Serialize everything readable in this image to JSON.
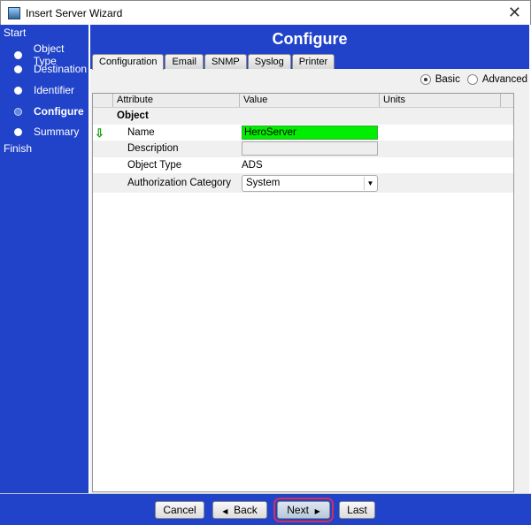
{
  "window": {
    "title": "Insert Server Wizard",
    "close": "✕"
  },
  "sidebar": {
    "start": "Start",
    "finish": "Finish",
    "items": [
      {
        "label": "Object Type",
        "current": false
      },
      {
        "label": "Destination",
        "current": false
      },
      {
        "label": "Identifier",
        "current": false
      },
      {
        "label": "Configure",
        "current": true
      },
      {
        "label": "Summary",
        "current": false
      }
    ]
  },
  "header": {
    "title": "Configure"
  },
  "tabs": [
    "Configuration",
    "Email",
    "SNMP",
    "Syslog",
    "Printer"
  ],
  "mode": {
    "basic": "Basic",
    "advanced": "Advanced",
    "selected": "Basic"
  },
  "table": {
    "columns": [
      "Attribute",
      "Value",
      "Units"
    ],
    "group": "Object",
    "rows": [
      {
        "attribute": "Name",
        "value": "HeroServer",
        "state": "modified-valid"
      },
      {
        "attribute": "Description",
        "value": ""
      },
      {
        "attribute": "Object Type",
        "value": "ADS"
      },
      {
        "attribute": "Authorization Category",
        "value": "System"
      }
    ]
  },
  "buttons": {
    "cancel": "Cancel",
    "back": "Back",
    "next": "Next",
    "last": "Last"
  },
  "colors": {
    "accent": "#2143c9",
    "valid": "#00ee00",
    "highlight": "#d0305a"
  }
}
